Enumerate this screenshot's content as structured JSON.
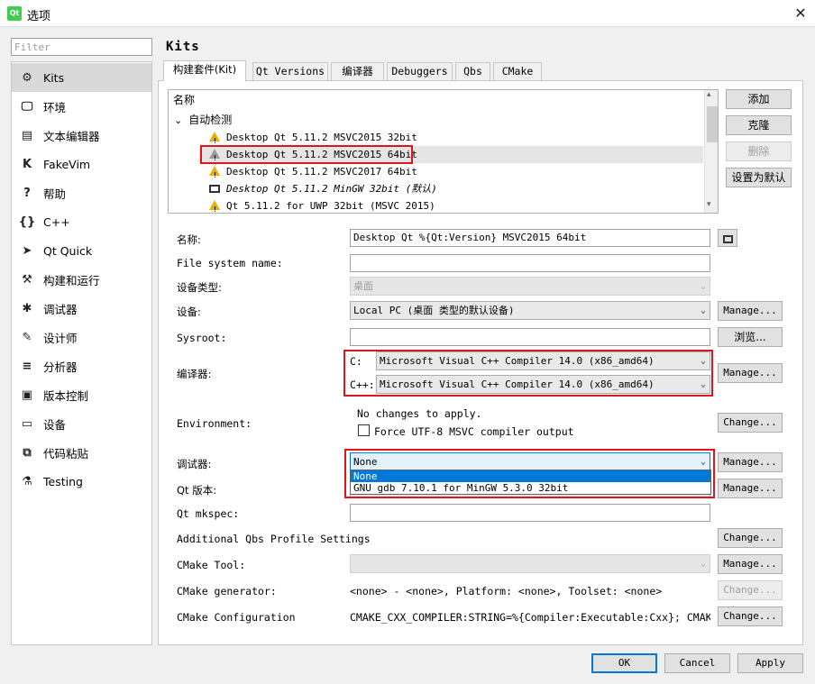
{
  "window": {
    "app_icon": "Qt",
    "title": "选项",
    "close": "✕"
  },
  "filter": {
    "placeholder": "Filter"
  },
  "sidebar": {
    "items": [
      {
        "label": "Kits",
        "icon": "kits-icon",
        "glyph": "⚙"
      },
      {
        "label": "环境",
        "icon": "monitor-icon",
        "glyph": "🖵"
      },
      {
        "label": "文本编辑器",
        "icon": "text-editor-icon",
        "glyph": "▤"
      },
      {
        "label": "FakeVim",
        "icon": "fakevim-icon",
        "glyph": "K"
      },
      {
        "label": "帮助",
        "icon": "help-icon",
        "glyph": "?"
      },
      {
        "label": "C++",
        "icon": "cpp-icon",
        "glyph": "{}"
      },
      {
        "label": "Qt Quick",
        "icon": "qt-quick-icon",
        "glyph": "➤"
      },
      {
        "label": "构建和运行",
        "icon": "hammer-icon",
        "glyph": "⚒"
      },
      {
        "label": "调试器",
        "icon": "bug-icon",
        "glyph": "✱"
      },
      {
        "label": "设计师",
        "icon": "pencil-icon",
        "glyph": "✎"
      },
      {
        "label": "分析器",
        "icon": "analyzer-icon",
        "glyph": "≡"
      },
      {
        "label": "版本控制",
        "icon": "version-control-icon",
        "glyph": "▣"
      },
      {
        "label": "设备",
        "icon": "device-icon",
        "glyph": "▭"
      },
      {
        "label": "代码粘贴",
        "icon": "code-paste-icon",
        "glyph": "⧉"
      },
      {
        "label": "Testing",
        "icon": "testing-icon",
        "glyph": "⚗"
      }
    ]
  },
  "page": {
    "heading": "Kits"
  },
  "tabs": [
    "构建套件(Kit)",
    "Qt Versions",
    "编译器",
    "Debuggers",
    "Qbs",
    "CMake"
  ],
  "kit_tree": {
    "header": "名称",
    "group": "自动检测",
    "group_toggle": "⌄",
    "kits": [
      "Desktop Qt 5.11.2 MSVC2015 32bit",
      "Desktop Qt 5.11.2 MSVC2015 64bit",
      "Desktop Qt 5.11.2 MSVC2017 64bit",
      "Desktop Qt 5.11.2 MinGW 32bit (默认)",
      "Qt 5.11.2 for UWP 32bit (MSVC 2015)"
    ],
    "scroll_up": "▴",
    "scroll_down": "▾"
  },
  "kit_buttons": {
    "add": "添加",
    "clone": "克隆",
    "remove": "删除",
    "make_default": "设置为默认"
  },
  "form": {
    "name_label": "名称:",
    "name_value": "Desktop Qt %{Qt:Version} MSVC2015 64bit",
    "fs_label": "File system name:",
    "fs_value": "",
    "device_type_label": "设备类型:",
    "device_type_value": "桌面",
    "device_label": "设备:",
    "device_value": "Local PC (桌面 类型的默认设备)",
    "sysroot_label": "Sysroot:",
    "sysroot_value": "",
    "browse": "浏览...",
    "compiler_label": "编译器:",
    "c_label": "C:",
    "c_value": "Microsoft Visual C++ Compiler 14.0 (x86_amd64)",
    "cpp_label": "C++:",
    "cpp_value": "Microsoft Visual C++ Compiler 14.0 (x86_amd64)",
    "env_label": "Environment:",
    "env_status": "No changes to apply.",
    "force_utf8": "Force UTF-8 MSVC compiler output",
    "debugger_label": "调试器:",
    "debugger_value": "None",
    "debugger_options": [
      "None",
      "GNU gdb 7.10.1 for MinGW 5.3.0 32bit"
    ],
    "qt_version_label": "Qt 版本:",
    "mkspec_label": "Qt mkspec:",
    "mkspec_value": "",
    "qbs_label": "Additional Qbs Profile Settings",
    "cmake_tool_label": "CMake Tool:",
    "cmake_gen_label": "CMake generator:",
    "cmake_gen_value": "<none> - <none>, Platform: <none>, Toolset: <none>",
    "cmake_config_label": "CMake Configuration",
    "cmake_config_value": "CMAKE_CXX_COMPILER:STRING=%{Compiler:Executable:Cxx}; CMAKE_C_CO...",
    "manage": "Manage...",
    "change": "Change...",
    "dropdown_arrow": "⌄"
  },
  "footer": {
    "ok": "OK",
    "cancel": "Cancel",
    "apply": "Apply"
  },
  "colors": {
    "highlight_border": "#e0141e",
    "selection": "#0078d7"
  }
}
